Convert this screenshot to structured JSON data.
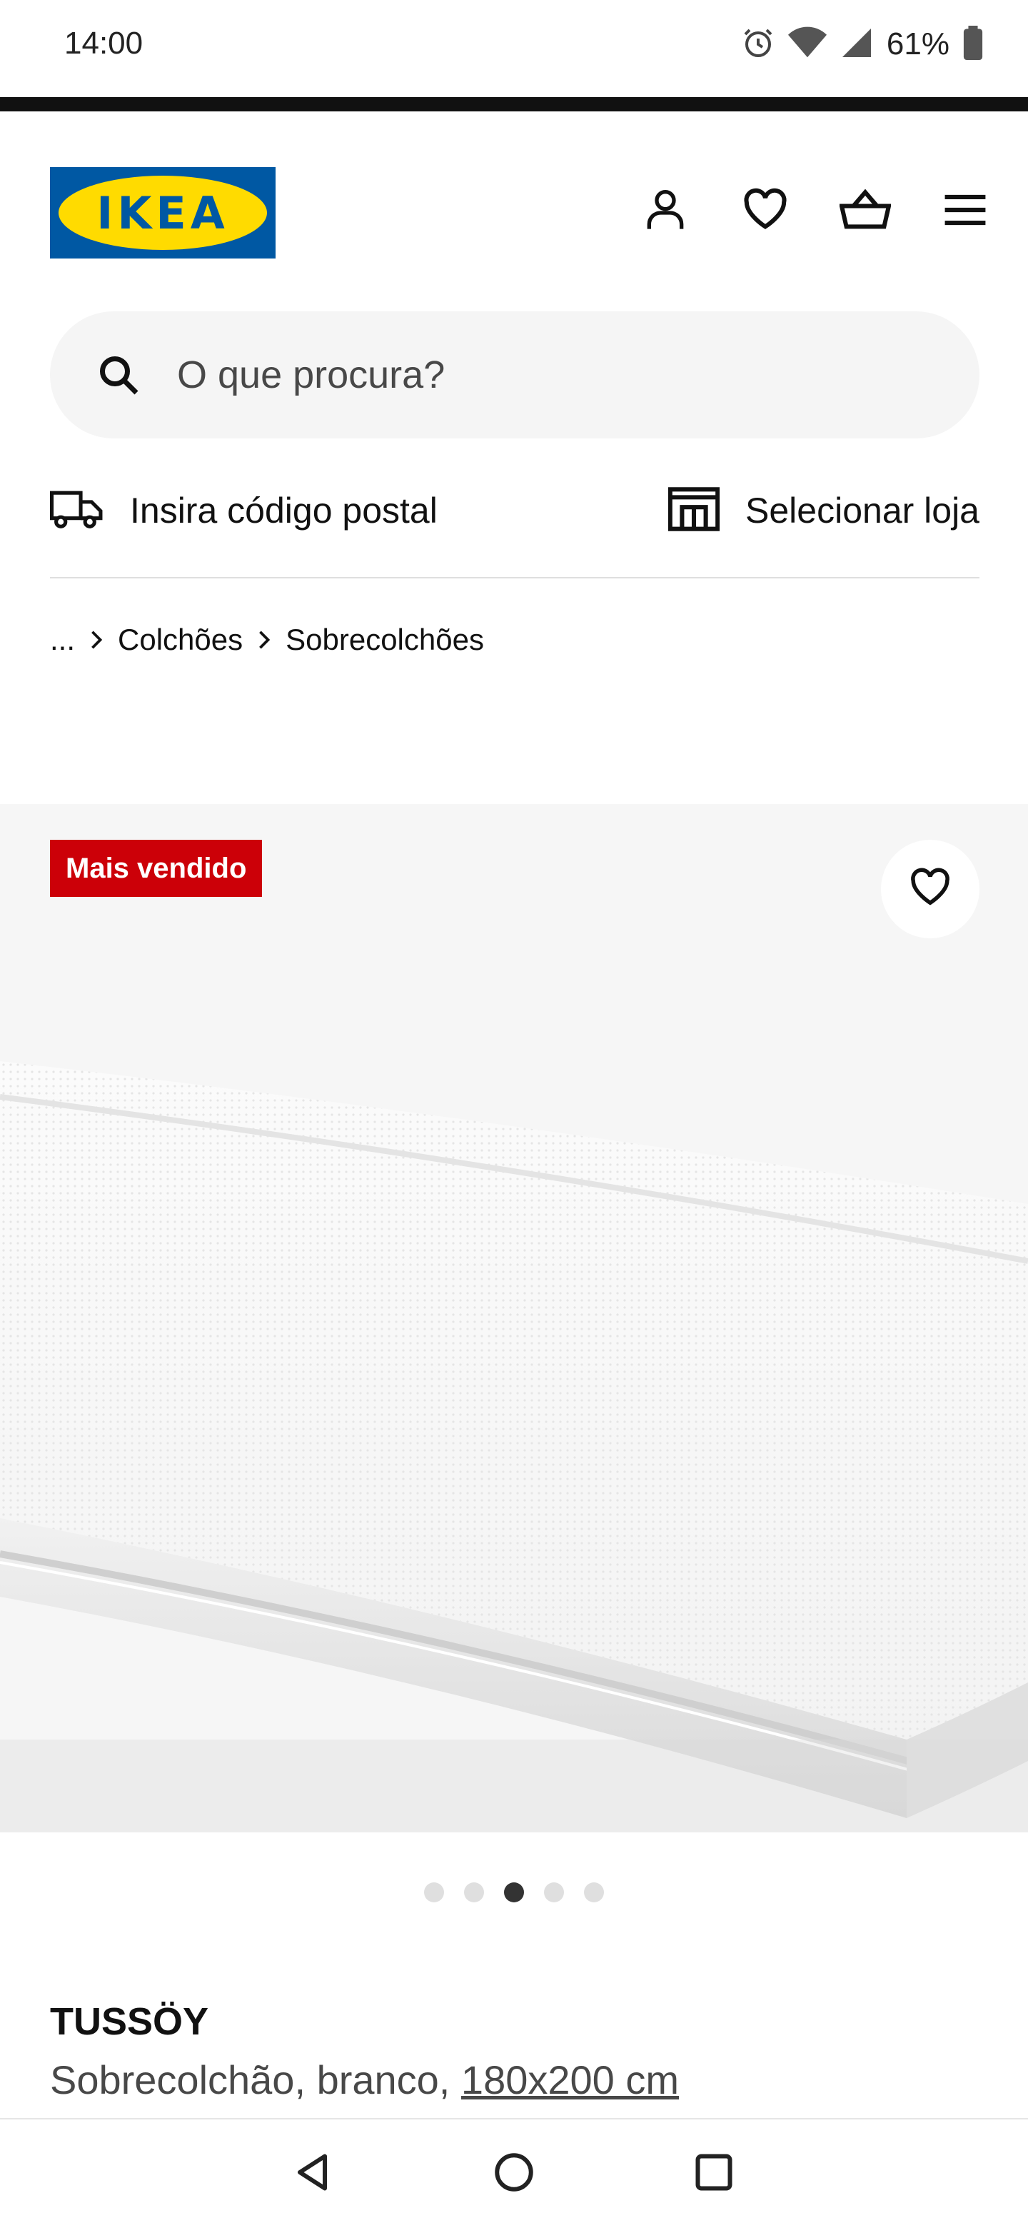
{
  "status_bar": {
    "time": "14:00",
    "battery": "61%"
  },
  "header": {
    "logo_text": "IKEA",
    "icons": [
      "profile-icon",
      "heart-icon",
      "basket-icon",
      "menu-icon"
    ]
  },
  "search": {
    "placeholder": "O que procura?"
  },
  "location": {
    "postal_label": "Insira código postal",
    "store_label": "Selecionar loja"
  },
  "breadcrumb": {
    "ellipsis": "...",
    "items": [
      "Colchões",
      "Sobrecolchões"
    ]
  },
  "product": {
    "badge": "Mais vendido",
    "name": "TUSSÖY",
    "description": "Sobrecolchão, branco, ",
    "size": "180x200 cm",
    "image_count": 5,
    "active_image": 3
  },
  "colors": {
    "ikea_blue": "#0058a3",
    "ikea_yellow": "#ffdb00",
    "badge_red": "#cc0008"
  }
}
